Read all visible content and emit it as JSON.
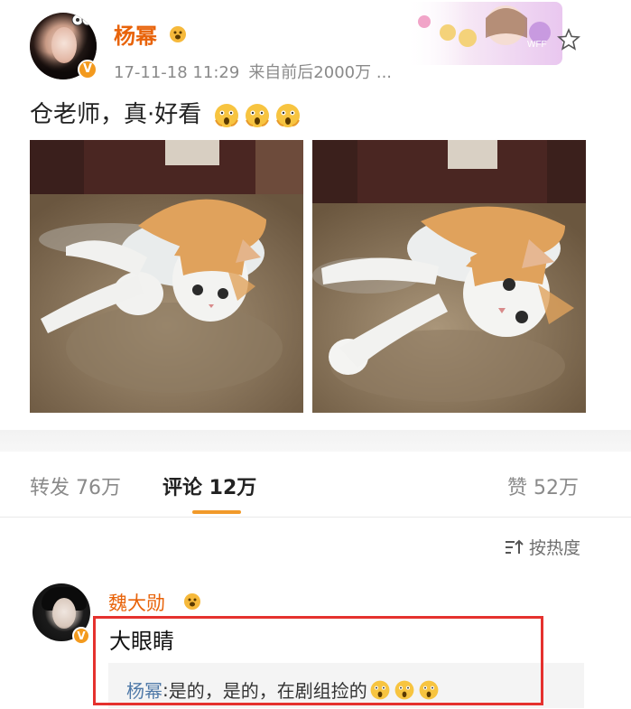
{
  "post": {
    "author": "杨幂",
    "timestamp": "17-11-18 11:29",
    "source": "来自前后2000万 ...",
    "text": "仓老师，真·好看",
    "text_emojis": [
      "scared-face-icon",
      "scared-face-icon",
      "scared-face-icon"
    ],
    "verified_badge": "V",
    "images": [
      "cat-photo-1",
      "cat-photo-2"
    ]
  },
  "tabs": {
    "repost": "转发 76万",
    "comment": "评论 12万",
    "like": "赞 52万"
  },
  "sort": {
    "label": "按热度"
  },
  "comment": {
    "author": "魏大勋",
    "verified_badge": "V",
    "text": "大眼睛",
    "reply_author": "杨幂",
    "reply_text": "是的，是的，在剧组捡的",
    "reply_emojis": [
      "scared-face-icon",
      "scared-face-icon",
      "scared-face-icon"
    ]
  },
  "colors": {
    "username": "#e8630a",
    "accent": "#f19a2a",
    "highlight": "#e5312e",
    "reply_author": "#4f79a8"
  }
}
